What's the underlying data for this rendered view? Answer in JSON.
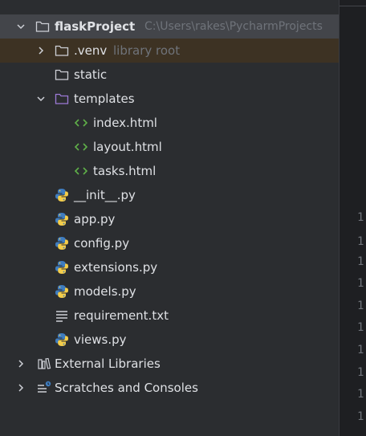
{
  "tree": {
    "project": {
      "name": "flaskProject",
      "path": "C:\\Users\\rakes\\PycharmProjects"
    },
    "venv": {
      "name": ".venv",
      "hint": "library root"
    },
    "static": {
      "name": "static"
    },
    "templates": {
      "name": "templates"
    },
    "template_files": [
      {
        "name": "index.html"
      },
      {
        "name": "layout.html"
      },
      {
        "name": "tasks.html"
      }
    ],
    "python_files": [
      {
        "name": "__init__.py"
      },
      {
        "name": "app.py"
      },
      {
        "name": "config.py"
      },
      {
        "name": "extensions.py"
      },
      {
        "name": "models.py"
      }
    ],
    "text_file": {
      "name": "requirement.txt"
    },
    "views_file": {
      "name": "views.py"
    },
    "external_libraries": {
      "name": "External Libraries"
    },
    "scratches": {
      "name": "Scratches and Consoles"
    }
  },
  "icons": {
    "chevron_collapsed": "chevron-right-icon",
    "chevron_expanded": "chevron-down-icon",
    "folder": "folder-icon",
    "templates_folder": "templates-folder-icon",
    "html": "html-file-icon",
    "python": "python-file-icon",
    "text": "text-file-icon",
    "libraries": "libraries-icon",
    "scratches": "scratches-icon"
  },
  "colors": {
    "panel_bg": "#2b2d30",
    "editor_bg": "#1e1f22",
    "selected_row": "#43454a",
    "venv_row": "#3d3223",
    "html_icon": "#5fb049",
    "templates_folder": "#9c7ad6",
    "python_blue": "#3f7dc0",
    "python_yellow": "#f4cd4a"
  },
  "editor_gutter": [
    "1",
    "1",
    "1",
    "1",
    "1",
    "1",
    "1",
    "1",
    "1",
    "1"
  ]
}
